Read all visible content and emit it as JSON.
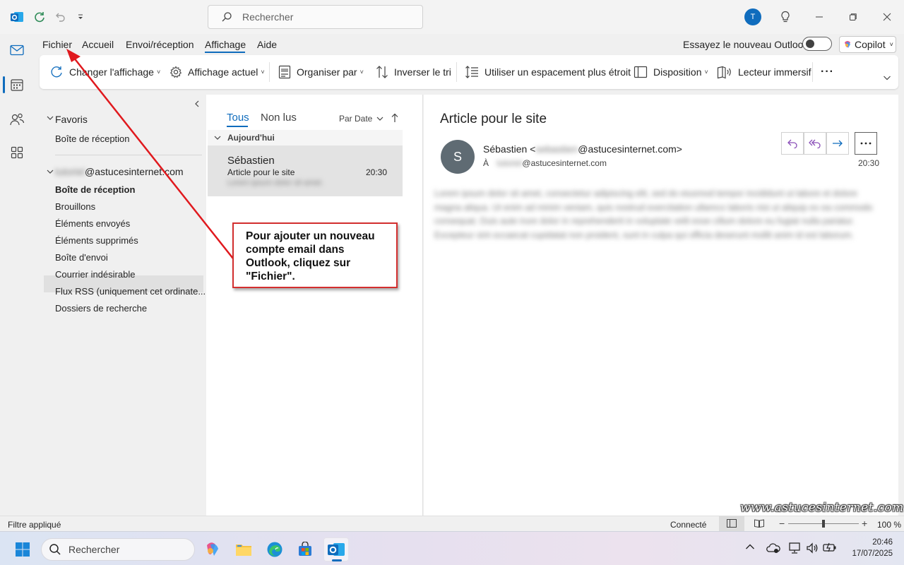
{
  "titlebar": {
    "search_placeholder": "Rechercher",
    "avatar_initial": "T"
  },
  "menu": {
    "tabs": [
      "Fichier",
      "Accueil",
      "Envoi/réception",
      "Affichage",
      "Aide"
    ],
    "active_tab": "Affichage",
    "try_new_outlook": "Essayez le nouveau Outlook",
    "copilot": "Copilot"
  },
  "ribbon": {
    "items": [
      "Changer l'affichage",
      "Affichage actuel",
      "Organiser par",
      "Inverser le tri",
      "Utiliser un espacement plus étroit",
      "Disposition",
      "Lecteur immersif"
    ],
    "more": "···"
  },
  "folders": {
    "favorites_label": "Favoris",
    "favorites": [
      "Boîte de réception"
    ],
    "account_blurred": "tutoriel",
    "account_domain": "@astucesinternet.com",
    "items": [
      "Boîte de réception",
      "Brouillons",
      "Éléments envoyés",
      "Éléments supprimés",
      "Boîte d'envoi",
      "Courrier indésirable",
      "Flux RSS (uniquement cet ordinate...",
      "Dossiers de recherche"
    ],
    "selected": "Boîte de réception"
  },
  "message_list": {
    "tab_all": "Tous",
    "tab_unread": "Non lus",
    "sort": "Par Date",
    "group": "Aujourd'hui",
    "message": {
      "sender": "Sébastien",
      "subject": "Article pour le site",
      "time": "20:30",
      "preview_blurred": "Lorem ipsum dolor sit amet."
    }
  },
  "reading": {
    "subject": "Article pour le site",
    "sender_initial": "S",
    "sender_name": "Sébastien <",
    "sender_blurred": "sebastien",
    "sender_domain": "@astucesinternet.com>",
    "to_label": "À",
    "to_blurred": "tutoriel",
    "to_domain": "@astucesinternet.com",
    "time": "20:30",
    "body_blurred": "Lorem ipsum dolor sit amet, consectetur adipiscing elit, sed do eiusmod tempor incididunt ut labore et dolore magna aliqua. Ut enim ad minim veniam, quis nostrud exercitation ullamco laboris nisi ut aliquip ex ea commodo consequat. Duis aute irure dolor in reprehenderit in voluptate velit esse cillum dolore eu fugiat nulla pariatur. Excepteur sint occaecat cupidatat non proident, sunt in culpa qui officia deserunt mollit anim id est laborum."
  },
  "statusbar": {
    "filter": "Filtre appliqué",
    "connection": "Connecté",
    "zoom": "100 %"
  },
  "taskbar": {
    "search": "Rechercher",
    "time": "20:46",
    "date": "17/07/2025"
  },
  "annotation": {
    "text": "Pour ajouter un nouveau compte email dans Outlook, cliquez sur \"Fichier\"."
  },
  "watermark": "www.astucesinternet.com",
  "colors": {
    "accent": "#0f6cbd",
    "annotation_red": "#d32f2f"
  }
}
